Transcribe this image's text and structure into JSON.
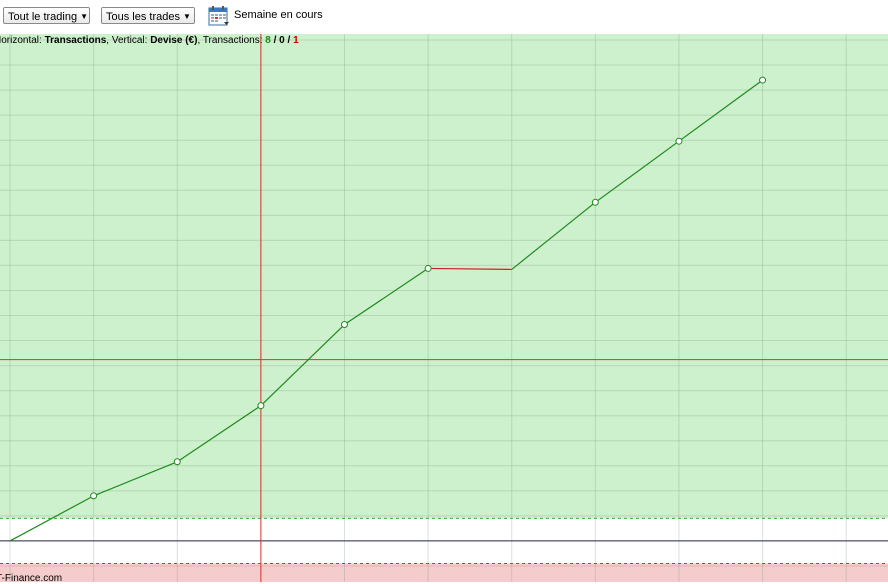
{
  "toolbar": {
    "trading_filter": "Tout le trading",
    "trades_filter": "Tous les trades",
    "period_label": "Semaine en cours",
    "calendar_icon": "calendar-icon"
  },
  "stats": {
    "horizontal_prefix": "Horizontal: ",
    "horizontal_value": "Transactions",
    "vertical_prefix": ", Vertical: ",
    "vertical_value": "Devise (€)",
    "transactions_prefix": ", Transactions: ",
    "winning": "8",
    "sep1": " / ",
    "neutral": "0",
    "sep2": " / ",
    "losing": "1"
  },
  "footer": {
    "brand": "T-Finance.com"
  },
  "colors": {
    "profit_zone": "#cdf0cd",
    "loss_zone": "#f5cccc",
    "gain_line": "#1f8a1f",
    "loss_segment": "#cc2222",
    "crosshair": "#e03030"
  },
  "chart_data": {
    "type": "line",
    "title": "",
    "xlabel": "Transactions",
    "ylabel": "Devise (€)",
    "x": [
      0,
      1,
      2,
      3,
      4,
      5,
      6,
      7,
      8,
      9
    ],
    "values": [
      0,
      0.9,
      1.58,
      2.7,
      4.32,
      5.44,
      5.42,
      6.76,
      7.98,
      9.2
    ],
    "loss_segments": [
      [
        5,
        6
      ]
    ],
    "xlim": [
      -0.12,
      10.5
    ],
    "ylim": [
      -0.82,
      10.12
    ],
    "grid": true,
    "crosshair": {
      "x": 3,
      "y": 3.62
    },
    "threshold_profit": 0.45,
    "threshold_loss": -0.45
  }
}
